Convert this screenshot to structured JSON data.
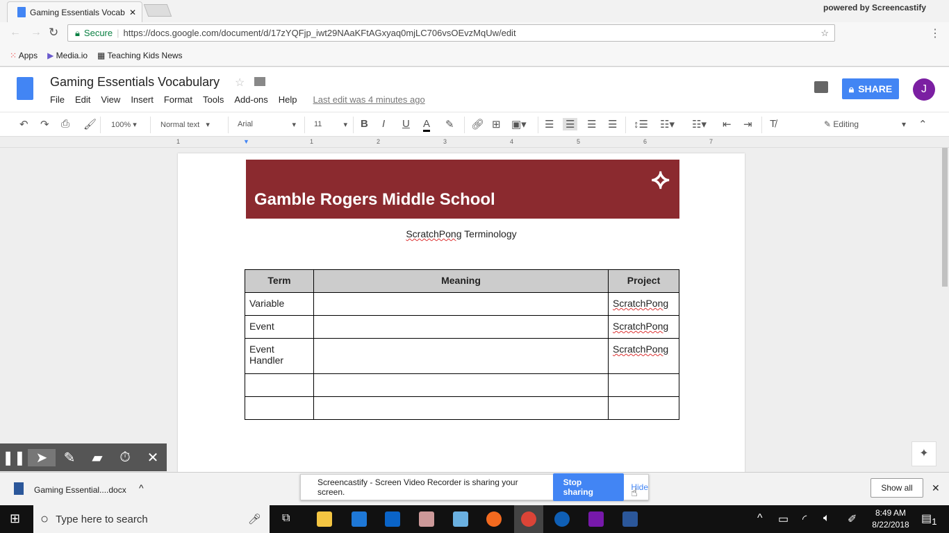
{
  "browser": {
    "tab_title": "Gaming Essentials Vocab",
    "secure_label": "Secure",
    "url": "https://docs.google.com/document/d/17zYQFjp_iwt29NAaKFtAGxyaq0mjLC706vsOEvzMqUw/edit",
    "bookmarks": [
      "Apps",
      "Media.io",
      "Teaching Kids News"
    ],
    "watermark": "powered by Screencastify"
  },
  "doc": {
    "title": "Gaming Essentials Vocabulary",
    "menu": [
      "File",
      "Edit",
      "View",
      "Insert",
      "Format",
      "Tools",
      "Add-ons",
      "Help"
    ],
    "last_edit": "Last edit was 4 minutes ago",
    "share_label": "SHARE",
    "avatar": "J",
    "share_color": "#4285f4",
    "avatar_color": "#7b1fa2"
  },
  "toolbar": {
    "zoom": "100%",
    "style": "Normal text",
    "font": "Arial",
    "size": "11",
    "mode": "Editing"
  },
  "ruler": [
    "1",
    "1",
    "2",
    "3",
    "4",
    "5",
    "6",
    "7"
  ],
  "content": {
    "banner": "Gamble Rogers Middle School",
    "banner_color": "#8b2a2f",
    "subtitle_a": "ScratchPong",
    "subtitle_b": " Terminology",
    "table": {
      "headers": [
        "Term",
        "Meaning",
        "Project"
      ],
      "rows": [
        [
          "Variable",
          "",
          "ScratchPong"
        ],
        [
          "Event",
          "",
          "ScratchPong"
        ],
        [
          "Event Handler",
          "",
          "ScratchPong"
        ],
        [
          "",
          "",
          ""
        ],
        [
          "",
          "",
          ""
        ]
      ]
    }
  },
  "sharing": {
    "message": "Screencastify - Screen Video Recorder is sharing your screen.",
    "stop": "Stop sharing",
    "hide": "Hide"
  },
  "downloads": {
    "file": "Gaming Essential....docx",
    "show_all": "Show all"
  },
  "taskbar": {
    "search": "Type here to search",
    "time": "8:49 AM",
    "date": "8/22/2018",
    "notif": "1"
  }
}
